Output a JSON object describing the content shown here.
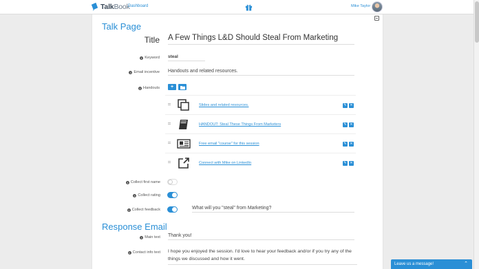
{
  "header": {
    "brand_bold": "Talk",
    "brand_light": "Book",
    "nav_dashboard": "Dashboard",
    "user_name": "Mike Taylor"
  },
  "page": {
    "heading": "Talk Page",
    "title_label": "Title",
    "title_value": "A Few Things L&D Should Steal From Marketing",
    "keyword_label": "Keyword",
    "keyword_value": "steal",
    "email_incentive_label": "Email incentive",
    "email_incentive_value": "Handouts and related resources.",
    "handouts_label": "Handouts",
    "add_button": "+",
    "folder_button_icon": "folder-icon",
    "handouts": [
      {
        "label": "Slides and related resources.",
        "icon": "copy-icon"
      },
      {
        "label": "HANDOUT: Steal These Things From Marketers",
        "icon": "book-icon"
      },
      {
        "label": "Free email \"course\" for this session",
        "icon": "newspaper-icon"
      },
      {
        "label": "Connect with Mike on LinkedIn",
        "icon": "external-link-icon"
      }
    ],
    "collect_first_name_label": "Collect first name",
    "collect_first_name": false,
    "collect_rating_label": "Collect rating",
    "collect_rating": true,
    "collect_feedback_label": "Collect feedback",
    "collect_feedback": true,
    "feedback_question": "What will you \"steal\" from Marketing?"
  },
  "response_email": {
    "heading": "Response Email",
    "main_text_label": "Main text",
    "main_text_value": "Thank you!",
    "contact_info_label": "Contact info text",
    "contact_info_value": "I hope you enjoyed the session. I'd love to hear your feedback and/or if you try any of the things we discussed and how it went."
  },
  "chat": {
    "label": "Leave us a message!"
  },
  "colors": {
    "accent": "#2a8fd6",
    "background": "#ececec"
  }
}
